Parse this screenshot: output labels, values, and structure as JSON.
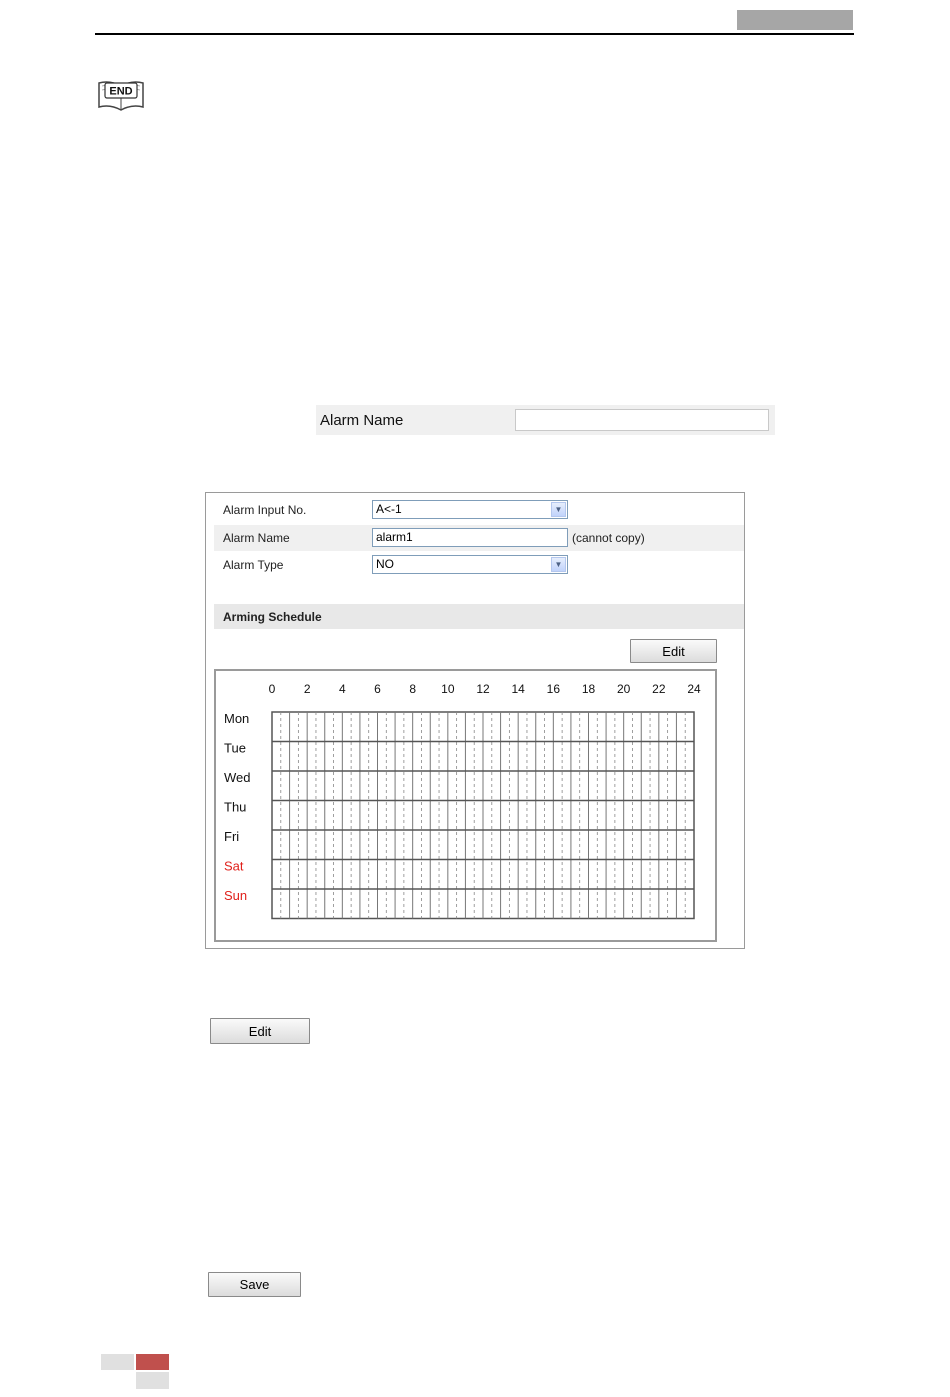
{
  "end_icon_label": "END",
  "snippet": {
    "label": "Alarm Name",
    "value": ""
  },
  "panel": {
    "alarm_input_no": {
      "label": "Alarm Input No.",
      "value": "A<-1"
    },
    "alarm_name": {
      "label": "Alarm Name",
      "value": "alarm1",
      "note": "(cannot copy)"
    },
    "alarm_type": {
      "label": "Alarm Type",
      "value": "NO"
    },
    "schedule_title": "Arming Schedule",
    "edit_label": "Edit"
  },
  "chart_data": {
    "type": "table",
    "hours": [
      "0",
      "2",
      "4",
      "6",
      "8",
      "10",
      "12",
      "14",
      "16",
      "18",
      "20",
      "22",
      "24"
    ],
    "days": [
      {
        "label": "Mon",
        "weekend": false
      },
      {
        "label": "Tue",
        "weekend": false
      },
      {
        "label": "Wed",
        "weekend": false
      },
      {
        "label": "Thu",
        "weekend": false
      },
      {
        "label": "Fri",
        "weekend": false
      },
      {
        "label": "Sat",
        "weekend": true
      },
      {
        "label": "Sun",
        "weekend": true
      }
    ],
    "weekend_color": "#e0201b"
  },
  "buttons": {
    "edit": "Edit",
    "save": "Save"
  },
  "colors": {
    "footer_gray": "#e0e0e0",
    "footer_red": "#c0504d",
    "header_tag": "#a6a6a6"
  }
}
